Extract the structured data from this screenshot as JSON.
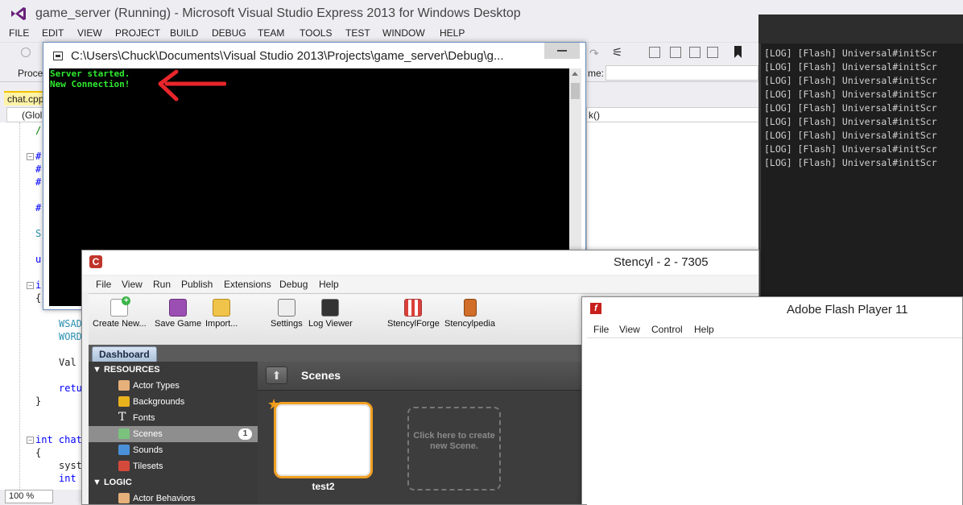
{
  "vs": {
    "title": "game_server (Running) - Microsoft Visual Studio Express 2013 for Windows Desktop",
    "menu": [
      "FILE",
      "EDIT",
      "VIEW",
      "PROJECT",
      "BUILD",
      "DEBUG",
      "TEAM",
      "TOOLS",
      "TEST",
      "WINDOW",
      "HELP"
    ],
    "process_label": "Proce",
    "name_label": "me:",
    "tab": "chat.cpp",
    "scope": "(Glol",
    "member_fragment": "k()",
    "zoom": "100 %",
    "code": [
      {
        "text": "/",
        "kw": false
      },
      {
        "text": "#",
        "kw": true
      },
      {
        "text": "#",
        "kw": true
      },
      {
        "text": "#",
        "kw": true
      },
      {
        "text": "#",
        "kw": true
      },
      {
        "text": "S",
        "kw": false
      },
      {
        "text": "u",
        "kw": true
      },
      {
        "text": "i",
        "kw": true
      },
      {
        "text": "{",
        "kw": false
      },
      {
        "text": "WSAD",
        "kw": false
      },
      {
        "text": "WORD",
        "kw": false
      },
      {
        "text": "Val",
        "kw": false
      },
      {
        "text": "retu",
        "kw": true
      },
      {
        "text": "}",
        "kw": false
      },
      {
        "text": "int chat",
        "kw": true
      },
      {
        "text": "{",
        "kw": false
      },
      {
        "text": "syst",
        "kw": false
      },
      {
        "text": "int",
        "kw": true
      }
    ]
  },
  "console": {
    "title": "C:\\Users\\Chuck\\Documents\\Visual Studio 2013\\Projects\\game_server\\Debug\\g...",
    "lines": [
      "Server started.",
      "New Connection!"
    ]
  },
  "log": {
    "lines": [
      "[LOG] [Flash] Universal#initScr",
      "[LOG] [Flash] Universal#initScr",
      "[LOG] [Flash] Universal#initScr",
      "[LOG] [Flash] Universal#initScr",
      "[LOG] [Flash] Universal#initScr",
      "[LOG] [Flash] Universal#initScr",
      "[LOG] [Flash] Universal#initScr",
      "[LOG] [Flash] Universal#initScr",
      "[LOG] [Flash] Universal#initScr"
    ]
  },
  "stencyl": {
    "title": "Stencyl - 2 - 7305",
    "menu": [
      "File",
      "View",
      "Run",
      "Publish",
      "Extensions",
      "Debug",
      "Help"
    ],
    "toolbar": [
      "Create New...",
      "Save Game",
      "Import...",
      "Settings",
      "Log Viewer",
      "StencylForge",
      "Stencylpedia"
    ],
    "dashboard_tab": "Dashboard",
    "resources_head": "RESOURCES",
    "resources": [
      "Actor Types",
      "Backgrounds",
      "Fonts",
      "Scenes",
      "Sounds",
      "Tilesets"
    ],
    "scenes_count": "1",
    "logic_head": "LOGIC",
    "logic": [
      "Actor Behaviors"
    ],
    "main_title": "Scenes",
    "scene_name": "test2",
    "new_scene": "Click here to create new Scene."
  },
  "flash": {
    "title": "Adobe Flash Player 11",
    "menu": [
      "File",
      "View",
      "Control",
      "Help"
    ]
  },
  "colors": {
    "console_text": "#2fea2f",
    "arrow": "#e8262b",
    "scene_border": "#f0a023"
  }
}
